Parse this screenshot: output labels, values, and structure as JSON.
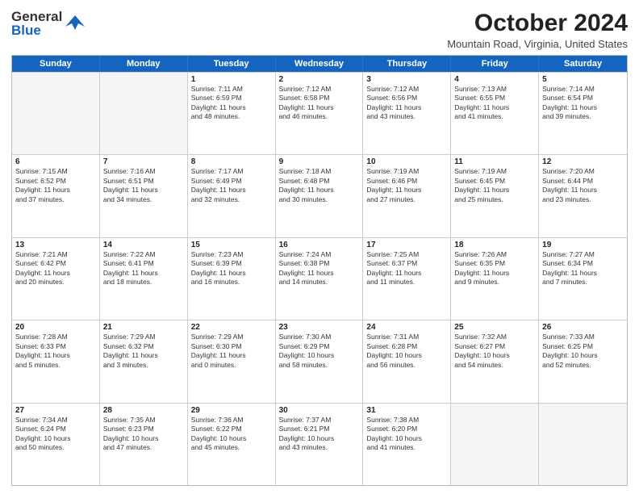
{
  "logo": {
    "line1": "General",
    "line2": "Blue"
  },
  "title": "October 2024",
  "location": "Mountain Road, Virginia, United States",
  "weekdays": [
    "Sunday",
    "Monday",
    "Tuesday",
    "Wednesday",
    "Thursday",
    "Friday",
    "Saturday"
  ],
  "weeks": [
    [
      {
        "day": "",
        "info": ""
      },
      {
        "day": "",
        "info": ""
      },
      {
        "day": "1",
        "info": "Sunrise: 7:11 AM\nSunset: 6:59 PM\nDaylight: 11 hours\nand 48 minutes."
      },
      {
        "day": "2",
        "info": "Sunrise: 7:12 AM\nSunset: 6:58 PM\nDaylight: 11 hours\nand 46 minutes."
      },
      {
        "day": "3",
        "info": "Sunrise: 7:12 AM\nSunset: 6:56 PM\nDaylight: 11 hours\nand 43 minutes."
      },
      {
        "day": "4",
        "info": "Sunrise: 7:13 AM\nSunset: 6:55 PM\nDaylight: 11 hours\nand 41 minutes."
      },
      {
        "day": "5",
        "info": "Sunrise: 7:14 AM\nSunset: 6:54 PM\nDaylight: 11 hours\nand 39 minutes."
      }
    ],
    [
      {
        "day": "6",
        "info": "Sunrise: 7:15 AM\nSunset: 6:52 PM\nDaylight: 11 hours\nand 37 minutes."
      },
      {
        "day": "7",
        "info": "Sunrise: 7:16 AM\nSunset: 6:51 PM\nDaylight: 11 hours\nand 34 minutes."
      },
      {
        "day": "8",
        "info": "Sunrise: 7:17 AM\nSunset: 6:49 PM\nDaylight: 11 hours\nand 32 minutes."
      },
      {
        "day": "9",
        "info": "Sunrise: 7:18 AM\nSunset: 6:48 PM\nDaylight: 11 hours\nand 30 minutes."
      },
      {
        "day": "10",
        "info": "Sunrise: 7:19 AM\nSunset: 6:46 PM\nDaylight: 11 hours\nand 27 minutes."
      },
      {
        "day": "11",
        "info": "Sunrise: 7:19 AM\nSunset: 6:45 PM\nDaylight: 11 hours\nand 25 minutes."
      },
      {
        "day": "12",
        "info": "Sunrise: 7:20 AM\nSunset: 6:44 PM\nDaylight: 11 hours\nand 23 minutes."
      }
    ],
    [
      {
        "day": "13",
        "info": "Sunrise: 7:21 AM\nSunset: 6:42 PM\nDaylight: 11 hours\nand 20 minutes."
      },
      {
        "day": "14",
        "info": "Sunrise: 7:22 AM\nSunset: 6:41 PM\nDaylight: 11 hours\nand 18 minutes."
      },
      {
        "day": "15",
        "info": "Sunrise: 7:23 AM\nSunset: 6:39 PM\nDaylight: 11 hours\nand 16 minutes."
      },
      {
        "day": "16",
        "info": "Sunrise: 7:24 AM\nSunset: 6:38 PM\nDaylight: 11 hours\nand 14 minutes."
      },
      {
        "day": "17",
        "info": "Sunrise: 7:25 AM\nSunset: 6:37 PM\nDaylight: 11 hours\nand 11 minutes."
      },
      {
        "day": "18",
        "info": "Sunrise: 7:26 AM\nSunset: 6:35 PM\nDaylight: 11 hours\nand 9 minutes."
      },
      {
        "day": "19",
        "info": "Sunrise: 7:27 AM\nSunset: 6:34 PM\nDaylight: 11 hours\nand 7 minutes."
      }
    ],
    [
      {
        "day": "20",
        "info": "Sunrise: 7:28 AM\nSunset: 6:33 PM\nDaylight: 11 hours\nand 5 minutes."
      },
      {
        "day": "21",
        "info": "Sunrise: 7:29 AM\nSunset: 6:32 PM\nDaylight: 11 hours\nand 3 minutes."
      },
      {
        "day": "22",
        "info": "Sunrise: 7:29 AM\nSunset: 6:30 PM\nDaylight: 11 hours\nand 0 minutes."
      },
      {
        "day": "23",
        "info": "Sunrise: 7:30 AM\nSunset: 6:29 PM\nDaylight: 10 hours\nand 58 minutes."
      },
      {
        "day": "24",
        "info": "Sunrise: 7:31 AM\nSunset: 6:28 PM\nDaylight: 10 hours\nand 56 minutes."
      },
      {
        "day": "25",
        "info": "Sunrise: 7:32 AM\nSunset: 6:27 PM\nDaylight: 10 hours\nand 54 minutes."
      },
      {
        "day": "26",
        "info": "Sunrise: 7:33 AM\nSunset: 6:25 PM\nDaylight: 10 hours\nand 52 minutes."
      }
    ],
    [
      {
        "day": "27",
        "info": "Sunrise: 7:34 AM\nSunset: 6:24 PM\nDaylight: 10 hours\nand 50 minutes."
      },
      {
        "day": "28",
        "info": "Sunrise: 7:35 AM\nSunset: 6:23 PM\nDaylight: 10 hours\nand 47 minutes."
      },
      {
        "day": "29",
        "info": "Sunrise: 7:36 AM\nSunset: 6:22 PM\nDaylight: 10 hours\nand 45 minutes."
      },
      {
        "day": "30",
        "info": "Sunrise: 7:37 AM\nSunset: 6:21 PM\nDaylight: 10 hours\nand 43 minutes."
      },
      {
        "day": "31",
        "info": "Sunrise: 7:38 AM\nSunset: 6:20 PM\nDaylight: 10 hours\nand 41 minutes."
      },
      {
        "day": "",
        "info": ""
      },
      {
        "day": "",
        "info": ""
      }
    ]
  ]
}
